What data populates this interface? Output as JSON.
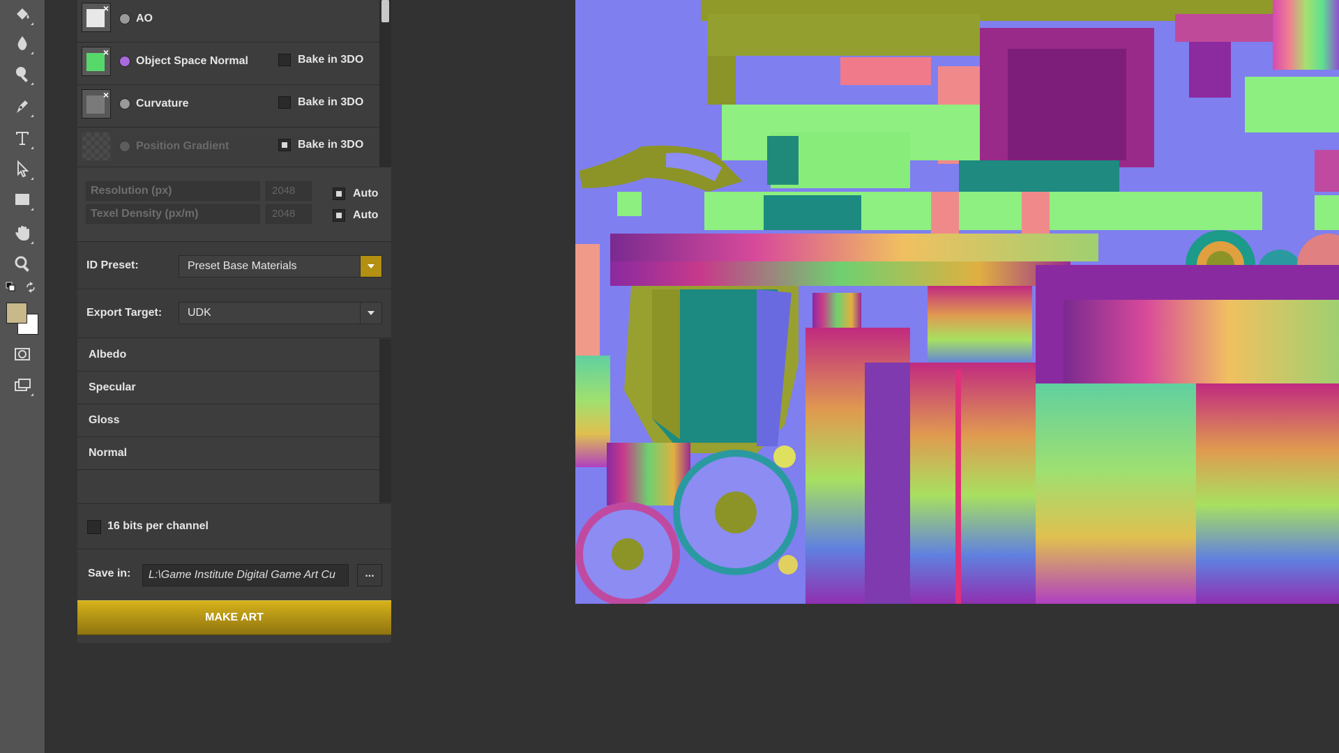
{
  "tools": [
    {
      "name": "paint-bucket-icon"
    },
    {
      "name": "blur-drop-icon"
    },
    {
      "name": "dodge-icon"
    },
    {
      "name": "pen-icon"
    },
    {
      "name": "type-icon"
    },
    {
      "name": "path-select-icon"
    },
    {
      "name": "rectangle-icon"
    },
    {
      "name": "hand-icon"
    },
    {
      "name": "zoom-icon"
    },
    {
      "name": "quick-mask-icon"
    },
    {
      "name": "screen-mode-icon"
    }
  ],
  "colors": {
    "foreground": "#c8b88a",
    "background": "#ffffff",
    "accent": "#c9a514"
  },
  "maps": [
    {
      "label": "AO"
    },
    {
      "label": "Object Space Normal",
      "bake_label": "Bake in 3DO",
      "bake_checked": false
    },
    {
      "label": "Curvature",
      "bake_label": "Bake in 3DO",
      "bake_checked": false
    },
    {
      "label": "Position Gradient",
      "bake_label": "Bake in 3DO",
      "bake_checked": true
    }
  ],
  "resolution": {
    "label": "Resolution (px)",
    "value": "2048",
    "auto_label": "Auto",
    "auto_checked": true
  },
  "texel_density": {
    "label": "Texel Density (px/m)",
    "value": "2048",
    "auto_label": "Auto",
    "auto_checked": true
  },
  "id_preset": {
    "label": "ID Preset:",
    "value": "Preset Base Materials"
  },
  "export_target": {
    "label": "Export Target:",
    "value": "UDK"
  },
  "channels": [
    "Albedo",
    "Specular",
    "Gloss",
    "Normal"
  ],
  "bits": {
    "label": "16 bits per channel",
    "checked": false
  },
  "save": {
    "label": "Save in:",
    "path": "L:\\Game Institute Digital Game Art  Cu",
    "browse_label": "..."
  },
  "make_art_label": "MAKE ART"
}
